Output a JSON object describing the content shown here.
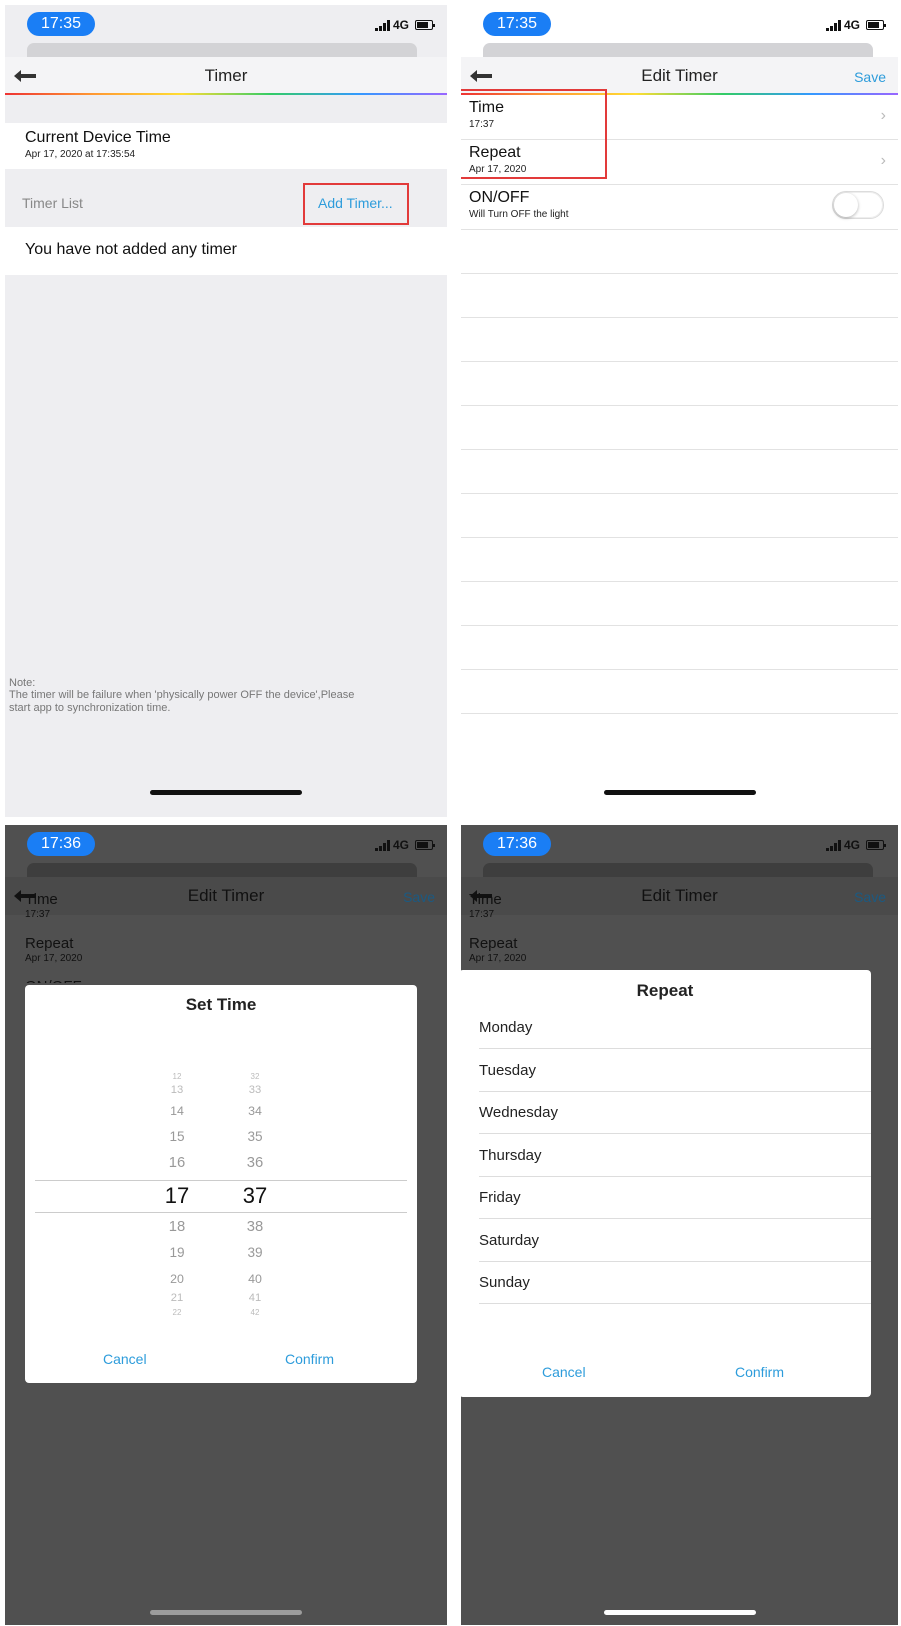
{
  "panel1": {
    "status_time": "17:35",
    "network": "4G",
    "nav_title": "Timer",
    "device_time_label": "Current Device Time",
    "device_time_value": "Apr 17, 2020 at 17:35:54",
    "timer_list_label": "Timer List",
    "add_timer": "Add Timer...",
    "empty_message": "You have not added any timer",
    "note_title": "Note:",
    "note_body": "The timer will be failure when 'physically power OFF the device',Please start app to synchronization time."
  },
  "panel2": {
    "status_time": "17:35",
    "network": "4G",
    "nav_title": "Edit Timer",
    "save": "Save",
    "time_label": "Time",
    "time_value": "17:37",
    "repeat_label": "Repeat",
    "repeat_value": "Apr 17, 2020",
    "onoff_label": "ON/OFF",
    "onoff_value": "Will Turn OFF the light",
    "toggle_on": false
  },
  "panel3": {
    "status_time": "17:36",
    "network": "4G",
    "nav_title": "Edit Timer",
    "save": "Save",
    "time_label": "Time",
    "time_value": "17:37",
    "repeat_label": "Repeat",
    "repeat_value": "Apr 17, 2020",
    "onoff_label": "ON/OFF",
    "modal_title": "Set Time",
    "hours": [
      "12",
      "13",
      "14",
      "15",
      "16",
      "17",
      "18",
      "19",
      "20",
      "21",
      "22"
    ],
    "minutes": [
      "32",
      "33",
      "34",
      "35",
      "36",
      "37",
      "38",
      "39",
      "40",
      "41",
      "42"
    ],
    "selected_hour": "17",
    "selected_minute": "37",
    "cancel": "Cancel",
    "confirm": "Confirm"
  },
  "panel4": {
    "status_time": "17:36",
    "network": "4G",
    "nav_title": "Edit Timer",
    "save": "Save",
    "time_label": "Time",
    "time_value": "17:37",
    "repeat_label": "Repeat",
    "repeat_value": "Apr 17, 2020",
    "modal_title": "Repeat",
    "days": [
      "Monday",
      "Tuesday",
      "Wednesday",
      "Thursday",
      "Friday",
      "Saturday",
      "Sunday"
    ],
    "cancel": "Cancel",
    "confirm": "Confirm"
  },
  "colors": {
    "accent": "#2d9cdb",
    "pill": "#1a7ef5",
    "highlight": "#e23a3a"
  }
}
